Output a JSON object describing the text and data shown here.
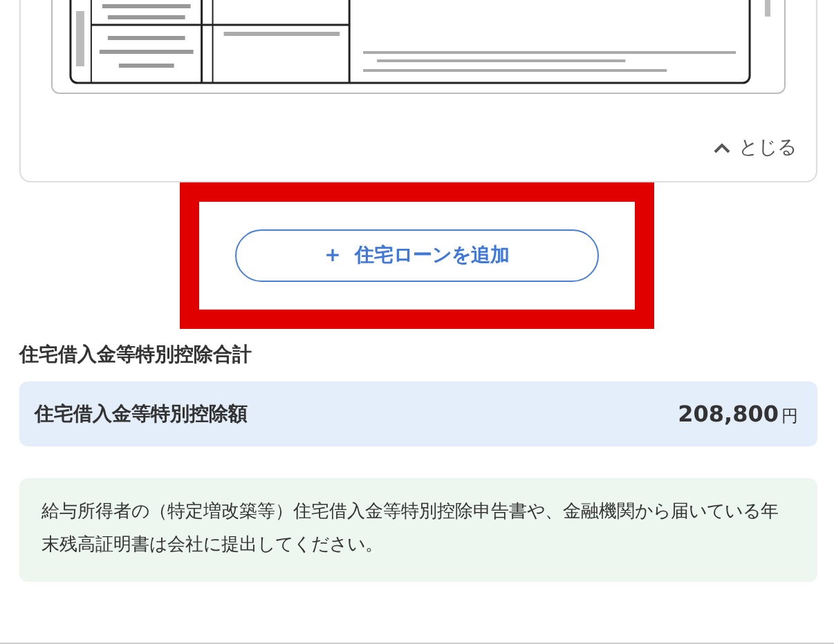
{
  "loan_detail": {
    "collapse_link": {
      "label": "とじる"
    }
  },
  "add_button": {
    "icon": "+",
    "label": "住宅ローンを追加",
    "highlighted": true
  },
  "summary": {
    "heading": "住宅借入金等特別控除合計",
    "label": "住宅借入金等特別控除額",
    "amount": "208,800",
    "unit": "円"
  },
  "notice": "給与所得者の（特定増改築等）住宅借入金等特別控除申告書や、金融機関から届いている年末残高証明書は会社に提出してください。"
}
